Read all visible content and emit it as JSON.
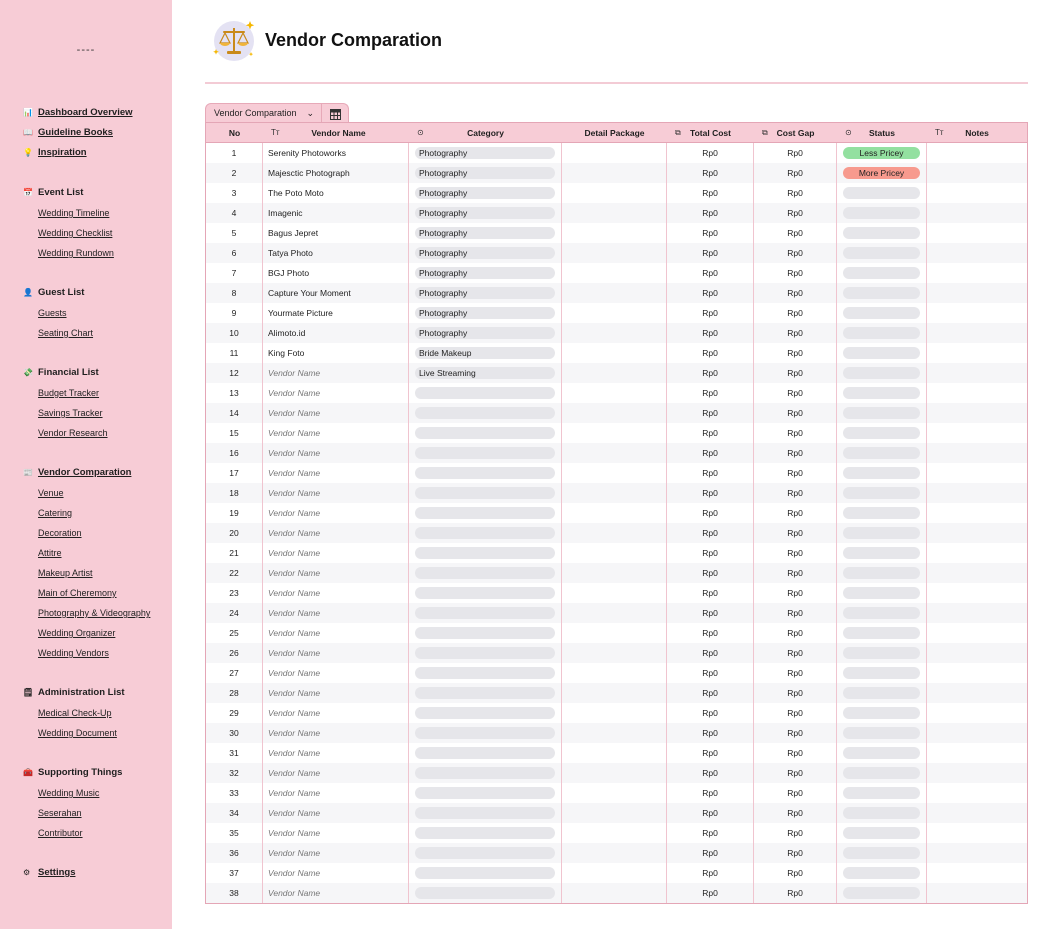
{
  "sidebar": {
    "top_text": "----",
    "groups": [
      {
        "items": [
          {
            "label": "Dashboard Overview",
            "icon": "📊",
            "icon_name": "chart-icon",
            "link": true
          },
          {
            "label": "Guideline Books",
            "icon": "📖",
            "icon_name": "book-icon",
            "link": true
          },
          {
            "label": "Inspiration",
            "icon": "💡",
            "icon_name": "lightbulb-icon",
            "link": true
          }
        ]
      },
      {
        "title": "Event List",
        "icon": "📅",
        "icon_name": "calendar-icon",
        "link": false,
        "items": [
          "Wedding Timeline",
          "Wedding Checklist",
          "Wedding Rundown"
        ]
      },
      {
        "title": "Guest List",
        "icon": "👤",
        "icon_name": "person-icon",
        "link": false,
        "items": [
          "Guests",
          "Seating Chart"
        ]
      },
      {
        "title": "Financial List",
        "icon": "💸",
        "icon_name": "money-icon",
        "link": false,
        "items": [
          "Budget Tracker",
          "Savings Tracker",
          "Vendor Research"
        ]
      },
      {
        "title": "Vendor Comparation",
        "icon": "📰",
        "icon_name": "document-icon",
        "link": true,
        "items": [
          "Venue",
          "Catering",
          "Decoration",
          "Attitre",
          "Makeup Artist",
          "Main of Cheremony",
          "Photography & Videography",
          "Wedding Organizer",
          "Wedding Vendors"
        ]
      },
      {
        "title": "Administration List",
        "icon": "🗒",
        "icon_name": "notepad-icon",
        "link": false,
        "items": [
          "Medical Check-Up",
          "Wedding Document"
        ]
      },
      {
        "title": "Supporting Things",
        "icon": "🧰",
        "icon_name": "toolbox-icon",
        "link": false,
        "items": [
          "Wedding Music",
          "Seserahan",
          "Contributor"
        ]
      },
      {
        "items": [
          {
            "label": "Settings",
            "icon": "⚙",
            "icon_name": "gear-icon",
            "link": true
          }
        ]
      }
    ]
  },
  "header": {
    "title": "Vendor Comparation",
    "icon_name": "balance-scale-icon"
  },
  "view": {
    "tab_label": "Vendor Comparation",
    "chevron": "⌄",
    "add_icon_name": "table-add-icon"
  },
  "table": {
    "columns": [
      {
        "label": "No",
        "icon": "",
        "icon_name": ""
      },
      {
        "label": "Vendor Name",
        "icon": "Tт",
        "icon_name": "text-type-icon"
      },
      {
        "label": "Category",
        "icon": "⊙",
        "icon_name": "select-icon"
      },
      {
        "label": "Detail Package",
        "icon": "",
        "icon_name": ""
      },
      {
        "label": "Total Cost",
        "icon": "⧉",
        "icon_name": "formula-icon"
      },
      {
        "label": "Cost Gap",
        "icon": "⧉",
        "icon_name": "formula-icon"
      },
      {
        "label": "Status",
        "icon": "⊙",
        "icon_name": "select-icon"
      },
      {
        "label": "Notes",
        "icon": "Tт",
        "icon_name": "text-type-icon"
      }
    ],
    "status_colors": {
      "Less Pricey": "#93e0a0",
      "More Pricey": "#f79a8e"
    },
    "rows": [
      {
        "no": "1",
        "name": "Serenity Photoworks",
        "placeholder": false,
        "category": "Photography",
        "total": "Rp0",
        "gap": "Rp0",
        "status": "Less Pricey"
      },
      {
        "no": "2",
        "name": "Majesctiс Photograph",
        "placeholder": false,
        "category": "Photography",
        "total": "Rp0",
        "gap": "Rp0",
        "status": "More Pricey"
      },
      {
        "no": "3",
        "name": "The Poto Moto",
        "placeholder": false,
        "category": "Photography",
        "total": "Rp0",
        "gap": "Rp0",
        "status": ""
      },
      {
        "no": "4",
        "name": "Imagenic",
        "placeholder": false,
        "category": "Photography",
        "total": "Rp0",
        "gap": "Rp0",
        "status": ""
      },
      {
        "no": "5",
        "name": "Bagus Jepret",
        "placeholder": false,
        "category": "Photography",
        "total": "Rp0",
        "gap": "Rp0",
        "status": ""
      },
      {
        "no": "6",
        "name": "Tatya Photo",
        "placeholder": false,
        "category": "Photography",
        "total": "Rp0",
        "gap": "Rp0",
        "status": ""
      },
      {
        "no": "7",
        "name": "BGJ Photo",
        "placeholder": false,
        "category": "Photography",
        "total": "Rp0",
        "gap": "Rp0",
        "status": ""
      },
      {
        "no": "8",
        "name": "Capture Your Moment",
        "placeholder": false,
        "category": "Photography",
        "total": "Rp0",
        "gap": "Rp0",
        "status": ""
      },
      {
        "no": "9",
        "name": "Yourmate Picture",
        "placeholder": false,
        "category": "Photography",
        "total": "Rp0",
        "gap": "Rp0",
        "status": ""
      },
      {
        "no": "10",
        "name": "Alimoto.id",
        "placeholder": false,
        "category": "Photography",
        "total": "Rp0",
        "gap": "Rp0",
        "status": ""
      },
      {
        "no": "11",
        "name": "King Foto",
        "placeholder": false,
        "category": "Bride Makeup",
        "total": "Rp0",
        "gap": "Rp0",
        "status": ""
      },
      {
        "no": "12",
        "name": "Vendor Name",
        "placeholder": true,
        "category": "Live Streaming",
        "total": "Rp0",
        "gap": "Rp0",
        "status": ""
      },
      {
        "no": "13",
        "name": "Vendor Name",
        "placeholder": true,
        "category": "",
        "total": "Rp0",
        "gap": "Rp0",
        "status": ""
      },
      {
        "no": "14",
        "name": "Vendor Name",
        "placeholder": true,
        "category": "",
        "total": "Rp0",
        "gap": "Rp0",
        "status": ""
      },
      {
        "no": "15",
        "name": "Vendor Name",
        "placeholder": true,
        "category": "",
        "total": "Rp0",
        "gap": "Rp0",
        "status": ""
      },
      {
        "no": "16",
        "name": "Vendor Name",
        "placeholder": true,
        "category": "",
        "total": "Rp0",
        "gap": "Rp0",
        "status": ""
      },
      {
        "no": "17",
        "name": "Vendor Name",
        "placeholder": true,
        "category": "",
        "total": "Rp0",
        "gap": "Rp0",
        "status": ""
      },
      {
        "no": "18",
        "name": "Vendor Name",
        "placeholder": true,
        "category": "",
        "total": "Rp0",
        "gap": "Rp0",
        "status": ""
      },
      {
        "no": "19",
        "name": "Vendor Name",
        "placeholder": true,
        "category": "",
        "total": "Rp0",
        "gap": "Rp0",
        "status": ""
      },
      {
        "no": "20",
        "name": "Vendor Name",
        "placeholder": true,
        "category": "",
        "total": "Rp0",
        "gap": "Rp0",
        "status": ""
      },
      {
        "no": "21",
        "name": "Vendor Name",
        "placeholder": true,
        "category": "",
        "total": "Rp0",
        "gap": "Rp0",
        "status": ""
      },
      {
        "no": "22",
        "name": "Vendor Name",
        "placeholder": true,
        "category": "",
        "total": "Rp0",
        "gap": "Rp0",
        "status": ""
      },
      {
        "no": "23",
        "name": "Vendor Name",
        "placeholder": true,
        "category": "",
        "total": "Rp0",
        "gap": "Rp0",
        "status": ""
      },
      {
        "no": "24",
        "name": "Vendor Name",
        "placeholder": true,
        "category": "",
        "total": "Rp0",
        "gap": "Rp0",
        "status": ""
      },
      {
        "no": "25",
        "name": "Vendor Name",
        "placeholder": true,
        "category": "",
        "total": "Rp0",
        "gap": "Rp0",
        "status": ""
      },
      {
        "no": "26",
        "name": "Vendor Name",
        "placeholder": true,
        "category": "",
        "total": "Rp0",
        "gap": "Rp0",
        "status": ""
      },
      {
        "no": "27",
        "name": "Vendor Name",
        "placeholder": true,
        "category": "",
        "total": "Rp0",
        "gap": "Rp0",
        "status": ""
      },
      {
        "no": "28",
        "name": "Vendor Name",
        "placeholder": true,
        "category": "",
        "total": "Rp0",
        "gap": "Rp0",
        "status": ""
      },
      {
        "no": "29",
        "name": "Vendor Name",
        "placeholder": true,
        "category": "",
        "total": "Rp0",
        "gap": "Rp0",
        "status": ""
      },
      {
        "no": "30",
        "name": "Vendor Name",
        "placeholder": true,
        "category": "",
        "total": "Rp0",
        "gap": "Rp0",
        "status": ""
      },
      {
        "no": "31",
        "name": "Vendor Name",
        "placeholder": true,
        "category": "",
        "total": "Rp0",
        "gap": "Rp0",
        "status": ""
      },
      {
        "no": "32",
        "name": "Vendor Name",
        "placeholder": true,
        "category": "",
        "total": "Rp0",
        "gap": "Rp0",
        "status": ""
      },
      {
        "no": "33",
        "name": "Vendor Name",
        "placeholder": true,
        "category": "",
        "total": "Rp0",
        "gap": "Rp0",
        "status": ""
      },
      {
        "no": "34",
        "name": "Vendor Name",
        "placeholder": true,
        "category": "",
        "total": "Rp0",
        "gap": "Rp0",
        "status": ""
      },
      {
        "no": "35",
        "name": "Vendor Name",
        "placeholder": true,
        "category": "",
        "total": "Rp0",
        "gap": "Rp0",
        "status": ""
      },
      {
        "no": "36",
        "name": "Vendor Name",
        "placeholder": true,
        "category": "",
        "total": "Rp0",
        "gap": "Rp0",
        "status": ""
      },
      {
        "no": "37",
        "name": "Vendor Name",
        "placeholder": true,
        "category": "",
        "total": "Rp0",
        "gap": "Rp0",
        "status": ""
      },
      {
        "no": "38",
        "name": "Vendor Name",
        "placeholder": true,
        "category": "",
        "total": "Rp0",
        "gap": "Rp0",
        "status": ""
      }
    ]
  },
  "colors": {
    "accent_pink": "#f7ccd6",
    "border_pink": "#e4a6b6",
    "pill_gray": "#e6e6ea"
  }
}
